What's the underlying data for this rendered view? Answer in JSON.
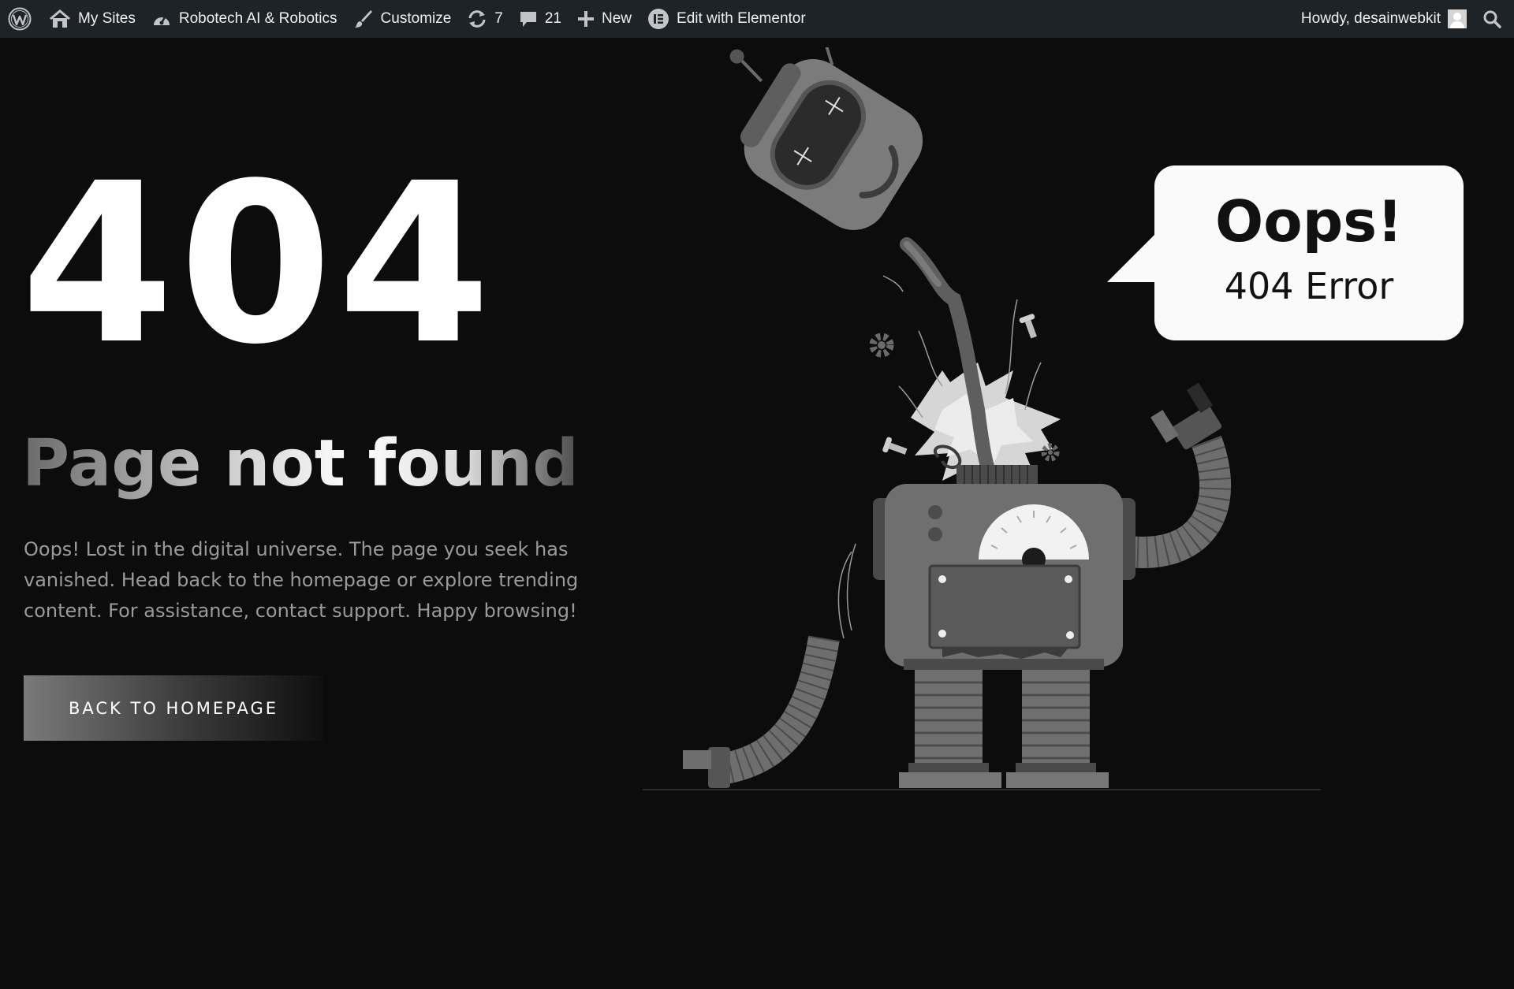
{
  "adminbar": {
    "wp_logo": "wordpress-icon",
    "my_sites": "My Sites",
    "site_name": "Robotech AI & Robotics",
    "customize": "Customize",
    "updates_count": "7",
    "comments_count": "21",
    "new_label": "New",
    "elementor_label": "Edit with Elementor",
    "greeting": "Howdy, desainwebkit"
  },
  "main": {
    "code": "404",
    "title": "Page not found",
    "description": "Oops! Lost in the digital universe. The page you seek has vanished. Head back to the homepage or explore trending content. For assistance, contact support. Happy browsing!",
    "button_label": "BACK TO HOMEPAGE"
  },
  "bubble": {
    "title": "Oops!",
    "subtitle": "404 Error"
  },
  "colors": {
    "background": "#0c0c0c",
    "adminbar": "#1d2327",
    "text": "#ffffff",
    "muted": "#9a9a9a",
    "robot_body": "#6f6f6f",
    "robot_dark": "#3a3a3a"
  }
}
